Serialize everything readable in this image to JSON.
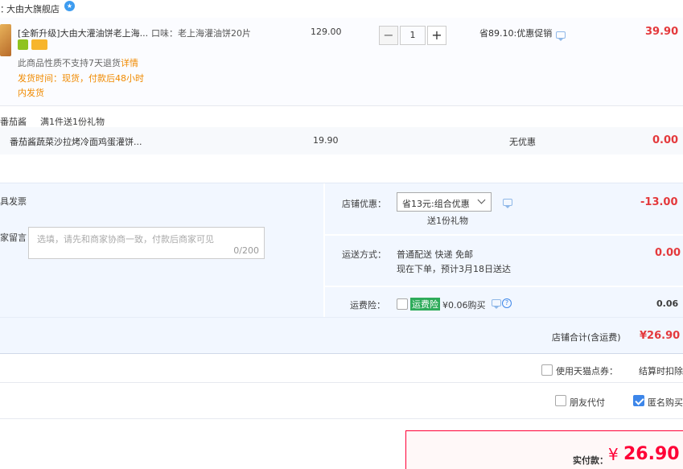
{
  "shop": {
    "prefix": "：",
    "name": "大由大旗舰店"
  },
  "item1": {
    "title": "[全新升级]大由大灌油饼老上海...",
    "spec": "口味：老上海灌油饼20片",
    "price": "129.00",
    "qty": "1",
    "promo": "省89.10:优惠促销",
    "subtotal": "39.90",
    "no_return": "此商品性质不支持7天退货",
    "detail_link": "详情",
    "ship_time_1": "发货时间：现货，付款后48小时",
    "ship_time_2": "内发货"
  },
  "gift": {
    "header_name": "番茄酱",
    "header_rule": "满1件送1份礼物",
    "title": "番茄酱蔬菜沙拉烤冷面鸡蛋灌饼...",
    "price": "19.90",
    "promo": "无优惠",
    "subtotal": "0.00"
  },
  "options": {
    "invoice_label": "具发票",
    "message_label": "家留言：",
    "message_placeholder": "选填，请先和商家协商一致，付款后商家可见",
    "message_count": "0/200",
    "store_discount_label": "店铺优惠：",
    "store_discount_value": "省13元:组合优惠",
    "store_discount_gift": "送1份礼物",
    "store_discount_amount": "-13.00",
    "shipping_label": "运送方式：",
    "shipping_value": "普通配送 快递 免邮",
    "shipping_eta": "现在下单，预计3月18日送达",
    "shipping_amount": "0.00",
    "insurance_label": "运费险：",
    "insurance_badge": "运费险",
    "insurance_price": "¥0.06购买",
    "insurance_amount": "0.06"
  },
  "store_total": {
    "label": "店铺合计(含运费)",
    "amount": "¥26.90"
  },
  "coupon": {
    "label": "使用天猫点券：",
    "value": "结算时扣除"
  },
  "friend_pay": {
    "label": "朋友代付"
  },
  "anonymous": {
    "label": "匿名购买"
  },
  "payment": {
    "label": "实付款：",
    "currency": "¥",
    "amount": "26.90"
  },
  "colors": {
    "accent_red": "#e4393c",
    "blue": "#3d86e9",
    "panel_bg": "#f2f7ff"
  }
}
